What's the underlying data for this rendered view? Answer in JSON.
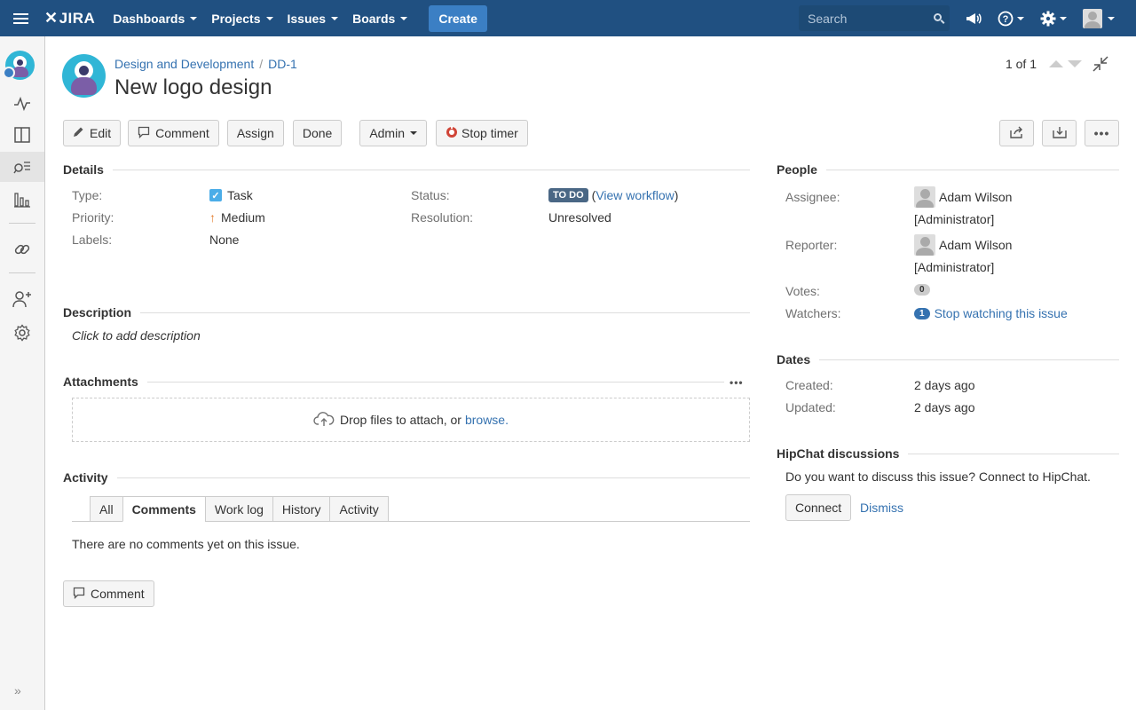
{
  "topnav": {
    "logo": "JIRA",
    "menus": [
      "Dashboards",
      "Projects",
      "Issues",
      "Boards"
    ],
    "create": "Create",
    "search_placeholder": "Search"
  },
  "header": {
    "breadcrumb_project": "Design and Development",
    "breadcrumb_sep": "/",
    "breadcrumb_key": "DD-1",
    "title": "New logo design",
    "pager": "1 of 1"
  },
  "toolbar": {
    "edit": "Edit",
    "comment": "Comment",
    "assign": "Assign",
    "done": "Done",
    "admin": "Admin",
    "stop_timer": "Stop timer"
  },
  "details": {
    "heading": "Details",
    "type_label": "Type:",
    "type_value": "Task",
    "priority_label": "Priority:",
    "priority_value": "Medium",
    "labels_label": "Labels:",
    "labels_value": "None",
    "status_label": "Status:",
    "status_value": "TO DO",
    "status_workflow_open": "(",
    "status_workflow_link": "View workflow",
    "status_workflow_close": ")",
    "resolution_label": "Resolution:",
    "resolution_value": "Unresolved"
  },
  "description": {
    "heading": "Description",
    "placeholder": "Click to add description"
  },
  "attachments": {
    "heading": "Attachments",
    "drop_text": "Drop files to attach, or",
    "browse": "browse."
  },
  "activity": {
    "heading": "Activity",
    "tabs": [
      "All",
      "Comments",
      "Work log",
      "History",
      "Activity"
    ],
    "active_tab": "Comments",
    "empty": "There are no comments yet on this issue.",
    "comment_button": "Comment"
  },
  "people": {
    "heading": "People",
    "assignee_label": "Assignee:",
    "assignee_name": "Adam Wilson",
    "assignee_role": "[Administrator]",
    "reporter_label": "Reporter:",
    "reporter_name": "Adam Wilson",
    "reporter_role": "[Administrator]",
    "votes_label": "Votes:",
    "votes_count": "0",
    "watchers_label": "Watchers:",
    "watchers_count": "1",
    "watchers_link": "Stop watching this issue"
  },
  "dates": {
    "heading": "Dates",
    "created_label": "Created:",
    "created_value": "2 days ago",
    "updated_label": "Updated:",
    "updated_value": "2 days ago"
  },
  "hipchat": {
    "heading": "HipChat discussions",
    "prompt": "Do you want to discuss this issue? Connect to HipChat.",
    "connect": "Connect",
    "dismiss": "Dismiss"
  },
  "colors": {
    "nav_bg": "#205081",
    "create_bg": "#3b7fc4",
    "link": "#3572b0",
    "status_lozenge": "#4a6785"
  },
  "icons": [
    "menu-icon",
    "jira-logo-icon",
    "search-icon",
    "notifications-icon",
    "help-icon",
    "settings-icon",
    "user-avatar-icon",
    "activity-icon",
    "board-icon",
    "issues-search-icon",
    "reports-icon",
    "link-icon",
    "add-user-icon",
    "project-settings-icon",
    "expand-sidebar-icon",
    "edit-icon",
    "comment-icon",
    "timer-icon",
    "share-icon",
    "export-icon",
    "more-icon",
    "task-icon",
    "priority-medium-icon",
    "cloud-upload-icon",
    "collapse-icon"
  ]
}
